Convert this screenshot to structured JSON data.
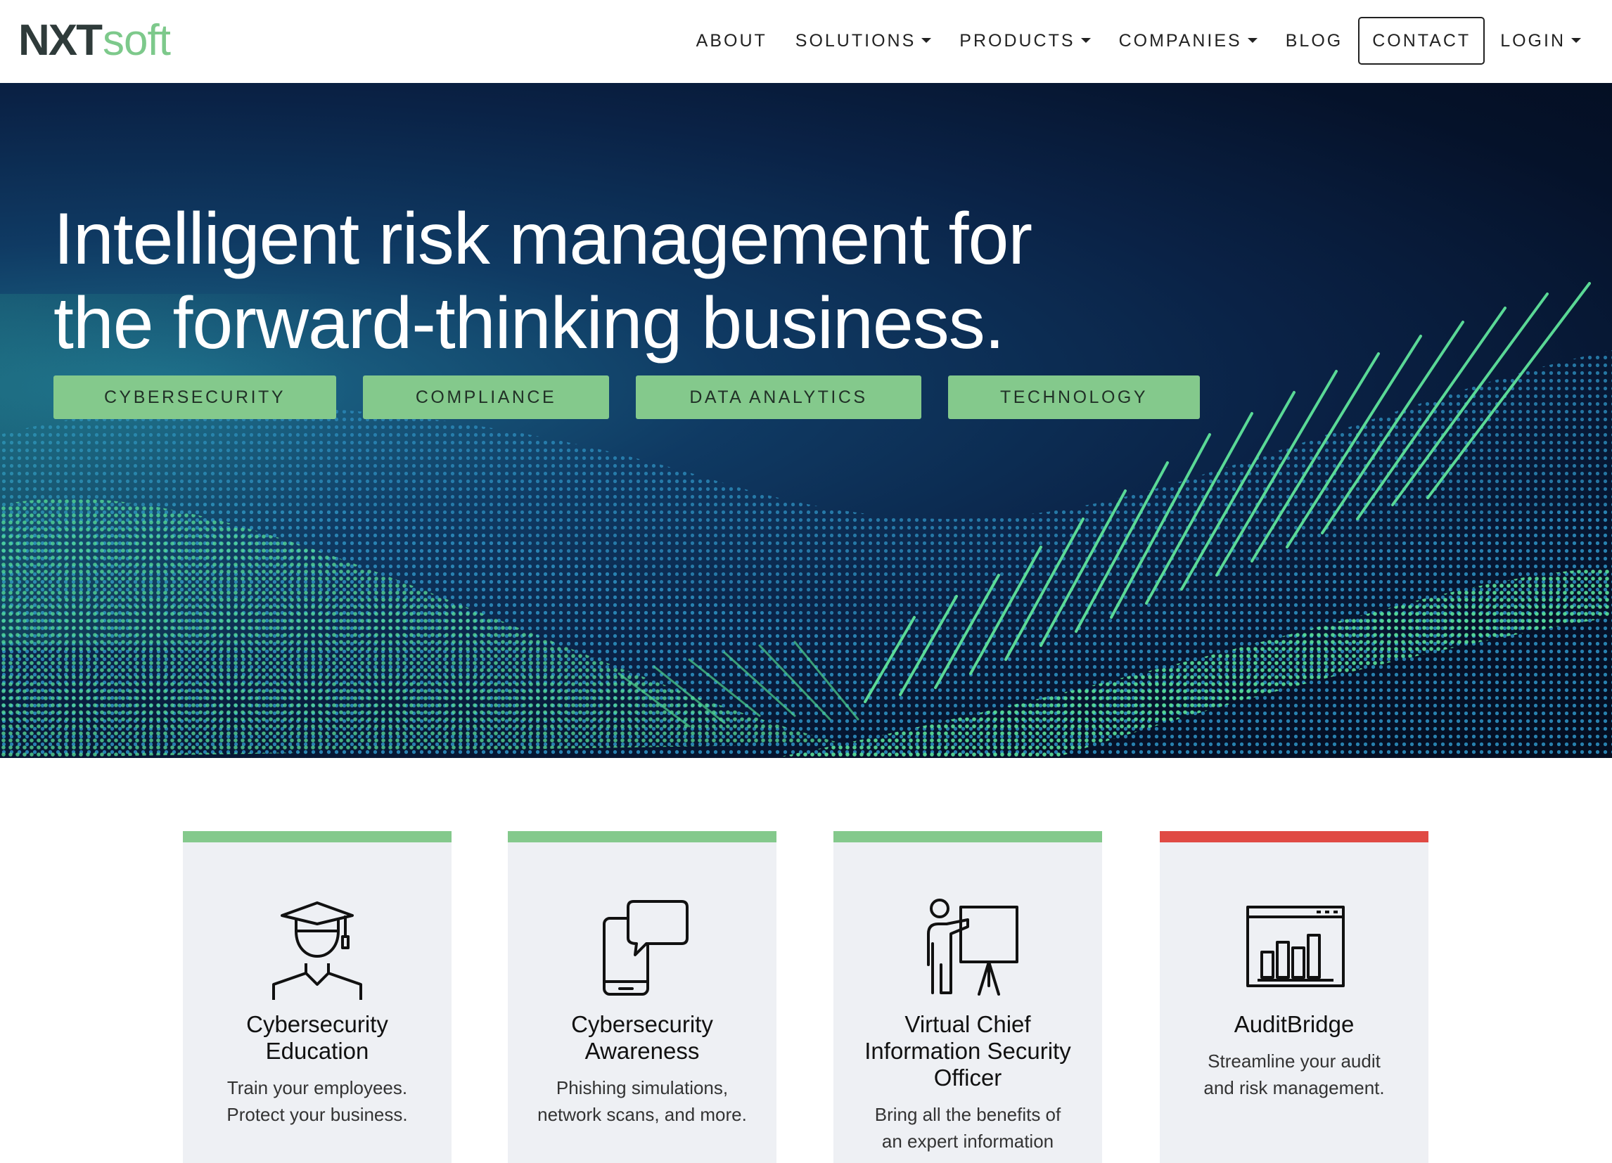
{
  "brand": {
    "logo_nxt": "NXT",
    "logo_soft": "soft",
    "green": "#84c98c",
    "red": "#e04a44"
  },
  "nav": {
    "items": [
      {
        "label": "ABOUT",
        "dropdown": false
      },
      {
        "label": "SOLUTIONS",
        "dropdown": true
      },
      {
        "label": "PRODUCTS",
        "dropdown": true
      },
      {
        "label": "COMPANIES",
        "dropdown": true
      },
      {
        "label": "BLOG",
        "dropdown": false
      }
    ],
    "contact": "CONTACT",
    "login": "LOGIN"
  },
  "hero": {
    "title_line1": "Intelligent risk management for",
    "title_line2": "the forward-thinking business.",
    "tags": [
      "CYBERSECURITY",
      "COMPLIANCE",
      "DATA ANALYTICS",
      "TECHNOLOGY"
    ]
  },
  "cards": [
    {
      "icon": "graduate-icon",
      "title_line1": "Cybersecurity",
      "title_line2": "Education",
      "desc_line1": "Train your employees.",
      "desc_line2": "Protect your business.",
      "accent": "#84c98c"
    },
    {
      "icon": "phone-chat-icon",
      "title_line1": "Cybersecurity",
      "title_line2": "Awareness",
      "desc_line1": "Phishing simulations,",
      "desc_line2": "network scans, and more.",
      "accent": "#84c98c"
    },
    {
      "icon": "presenter-icon",
      "title_line1": "Virtual Chief",
      "title_line2": "Information Security",
      "title_line3": "Officer",
      "desc_line1": "Bring all the benefits of",
      "desc_line2": "an expert information",
      "accent": "#84c98c"
    },
    {
      "icon": "bar-chart-window-icon",
      "title_line1": "AuditBridge",
      "desc_line1": "Streamline your audit",
      "desc_line2": "and risk management.",
      "accent": "#e04a44"
    }
  ]
}
